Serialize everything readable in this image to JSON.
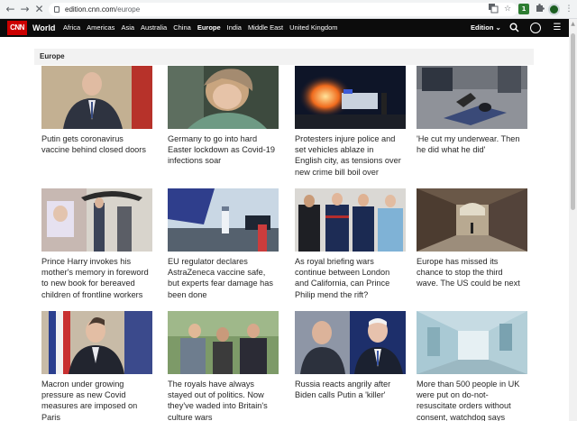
{
  "browser": {
    "url_host": "edition.cnn.com",
    "url_path": "/europe",
    "back_glyph": "←",
    "forward_glyph": "→",
    "stop_glyph": "✕",
    "extension_badge": "1"
  },
  "header": {
    "logo": "CNN",
    "section": "World",
    "regions": [
      "Africa",
      "Americas",
      "Asia",
      "Australia",
      "China",
      "Europe",
      "India",
      "Middle East",
      "United Kingdom"
    ],
    "active_region": "Europe",
    "edition_label": "Edition ⌄"
  },
  "section": {
    "title": "Europe"
  },
  "cards": [
    {
      "headline": "Putin gets coronavirus vaccine behind closed doors"
    },
    {
      "headline": "Germany to go into hard Easter lockdown as Covid-19 infections soar"
    },
    {
      "headline": "Protesters injure police and set vehicles ablaze in English city, as tensions over new crime bill boil over"
    },
    {
      "headline": "'He cut my underwear. Then he did what he did'"
    },
    {
      "headline": "Prince Harry invokes his mother's memory in foreword to new book for bereaved children of frontline workers"
    },
    {
      "headline": "EU regulator declares AstraZeneca vaccine safe, but experts fear damage has been done"
    },
    {
      "headline": "As royal briefing wars continue between London and California, can Prince Philip mend the rift?"
    },
    {
      "headline": "Europe has missed its chance to stop the third wave. The US could be next"
    },
    {
      "headline": "Macron under growing pressure as new Covid measures are imposed on Paris"
    },
    {
      "headline": "The royals have always stayed out of politics. Now they've waded into Britain's culture wars"
    },
    {
      "headline": "Russia reacts angrily after Biden calls Putin a 'killer'"
    },
    {
      "headline": "More than 500 people in UK were put on do-not-resuscitate orders without consent, watchdog says"
    }
  ]
}
